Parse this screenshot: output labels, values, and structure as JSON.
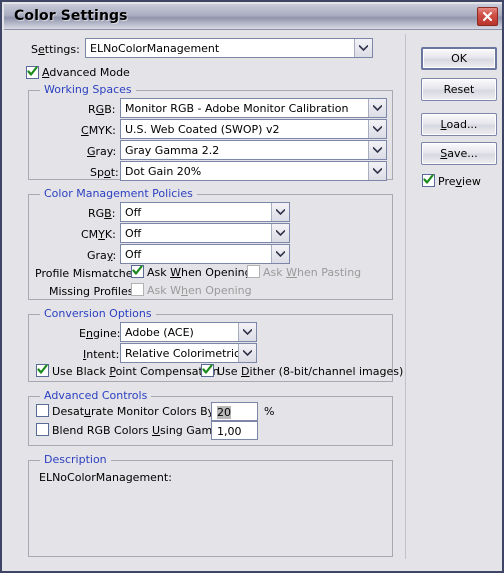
{
  "window": {
    "title": "Color Settings",
    "close_icon": "close-x-icon"
  },
  "settings_row": {
    "label": "Settings:",
    "value": "ELNoColorManagement"
  },
  "advanced_mode": {
    "label": "Advanced Mode",
    "checked": true
  },
  "working_spaces": {
    "legend": "Working Spaces",
    "rows": [
      {
        "label": "RGB:",
        "value": "Monitor RGB - Adobe Monitor Calibration"
      },
      {
        "label": "CMYK:",
        "value": "U.S. Web Coated (SWOP) v2"
      },
      {
        "label": "Gray:",
        "value": "Gray Gamma 2.2"
      },
      {
        "label": "Spot:",
        "value": "Dot Gain 20%"
      }
    ]
  },
  "color_management_policies": {
    "legend": "Color Management Policies",
    "rows": [
      {
        "label": "RGB:",
        "value": "Off"
      },
      {
        "label": "CMYK:",
        "value": "Off"
      },
      {
        "label": "Gray:",
        "value": "Off"
      }
    ],
    "profile_mismatches": {
      "label": "Profile Mismatches:",
      "ask_when_opening": {
        "label": "Ask When Opening",
        "checked": true,
        "disabled": false
      },
      "ask_when_pasting": {
        "label": "Ask When Pasting",
        "checked": false,
        "disabled": true
      }
    },
    "missing_profiles": {
      "label": "Missing Profiles:",
      "ask_when_opening": {
        "label": "Ask When Opening",
        "checked": false,
        "disabled": true
      }
    }
  },
  "conversion_options": {
    "legend": "Conversion Options",
    "engine": {
      "label": "Engine:",
      "value": "Adobe (ACE)"
    },
    "intent": {
      "label": "Intent:",
      "value": "Relative Colorimetric"
    },
    "black_point": {
      "label": "Use Black Point Compensation",
      "checked": true
    },
    "dither": {
      "label": "Use Dither (8-bit/channel images)",
      "checked": true
    }
  },
  "advanced_controls": {
    "legend": "Advanced Controls",
    "desaturate": {
      "label": "Desaturate Monitor Colors By:",
      "checked": false,
      "value": "20",
      "unit": "%"
    },
    "blend_gamma": {
      "label": "Blend RGB Colors Using Gamma:",
      "checked": false,
      "value": "1,00"
    }
  },
  "description": {
    "legend": "Description",
    "text": "ELNoColorManagement:"
  },
  "buttons": {
    "ok": "OK",
    "reset": "Reset",
    "load": "Load...",
    "save": "Save...",
    "preview": {
      "label": "Preview",
      "checked": true
    }
  },
  "colors": {
    "legend_blue": "#2b3fc0",
    "check_green": "#1a8a1a",
    "disabled_gray": "#9a9a9a",
    "dialog_bg": "#e4e4e8"
  }
}
